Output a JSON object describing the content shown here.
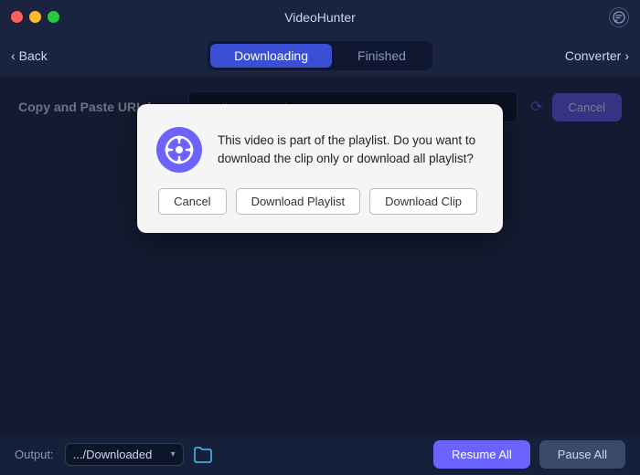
{
  "titlebar": {
    "title": "VideoHunter",
    "buttons": [
      "close",
      "minimize",
      "maximize"
    ]
  },
  "navbar": {
    "back_label": "Back",
    "tabs": [
      {
        "id": "downloading",
        "label": "Downloading",
        "active": true
      },
      {
        "id": "finished",
        "label": "Finished",
        "active": false
      }
    ],
    "converter_label": "Converter"
  },
  "url_section": {
    "label": "Copy and Paste URL here:",
    "placeholder": "ttps://www.youtube",
    "cancel_label": "Cancel"
  },
  "dialog": {
    "message": "This video is part of the playlist. Do you want to download the clip only or download all playlist?",
    "buttons": {
      "cancel": "Cancel",
      "download_playlist": "Download Playlist",
      "download_clip": "Download Clip"
    }
  },
  "bottom_bar": {
    "output_label": "Output:",
    "output_path": ".../Downloaded",
    "resume_label": "Resume All",
    "pause_label": "Pause All"
  },
  "icons": {
    "chat": "💬",
    "chevron_left": "‹",
    "chevron_right": "›",
    "folder": "📂",
    "dropdown_arrow": "▾",
    "spin": "⟳"
  }
}
